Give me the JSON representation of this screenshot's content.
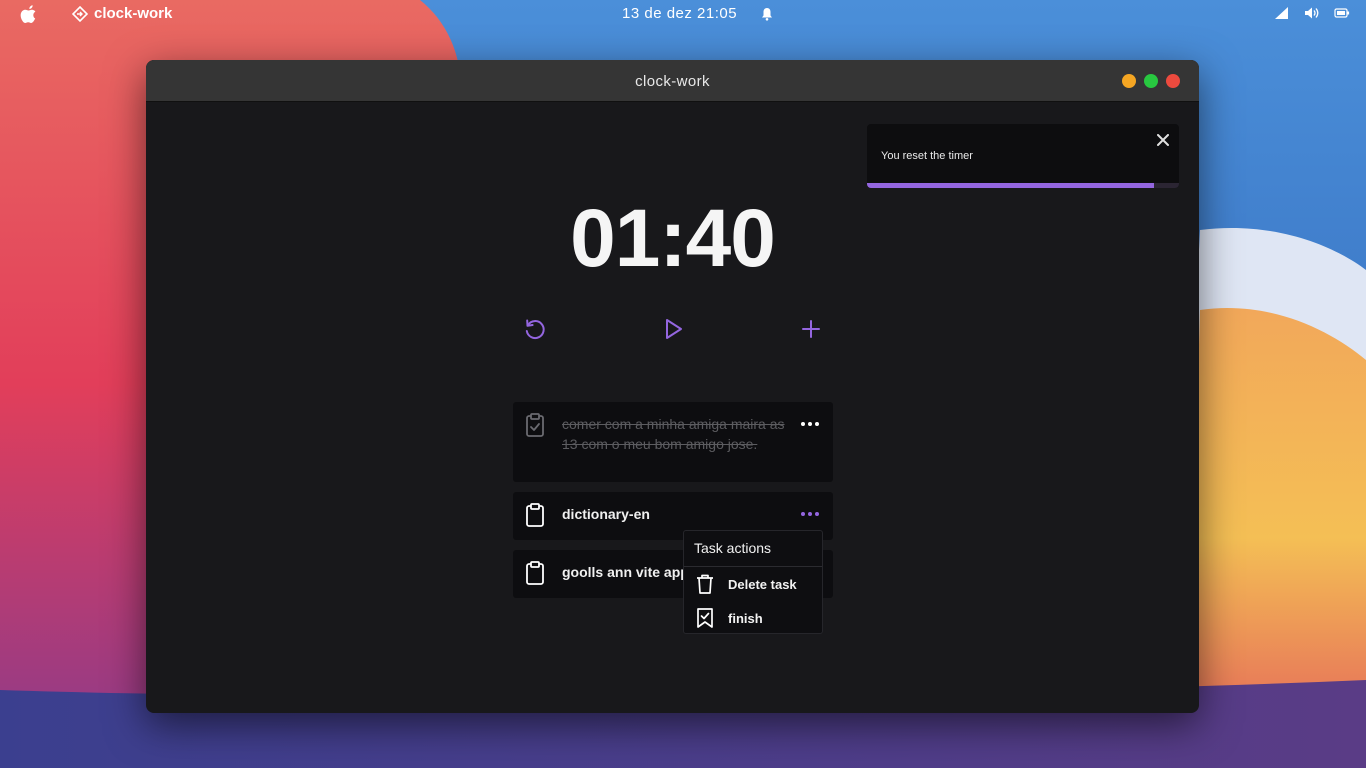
{
  "menubar": {
    "app_name": "clock-work",
    "clock": "13 de dez  21:05"
  },
  "window": {
    "title": "clock-work"
  },
  "timer": {
    "display": "01:40"
  },
  "controls": {
    "reset_icon": "rotate-ccw-icon",
    "play_icon": "play-icon",
    "add_icon": "plus-icon"
  },
  "tasks": [
    {
      "text": "comer com a minha amiga maira as 13 com o meu bom amigo jose.",
      "finished": true
    },
    {
      "text": "dictionary-en",
      "finished": false
    },
    {
      "text": "goolls ann vite app",
      "finished": false
    }
  ],
  "task_menu": {
    "title": "Task actions",
    "delete_label": "Delete task",
    "finish_label": "finish"
  },
  "toast": {
    "message": "You reset the timer",
    "progress": 0.92
  },
  "colors": {
    "accent": "#9466e0",
    "window_bg": "#18181b",
    "card_bg": "#0d0d10"
  }
}
